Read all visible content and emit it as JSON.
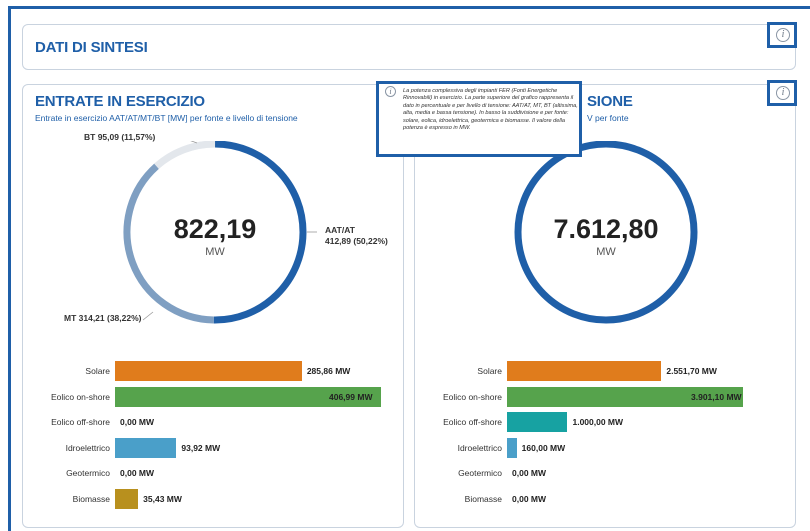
{
  "summary": {
    "title": "DATI DI SINTESI"
  },
  "info_icon_glyph": "i",
  "left_card": {
    "title": "ENTRATE IN ESERCIZIO",
    "subtitle": "Entrate in esercizio AAT/AT/MT/BT [MW] per fonte e livello di tensione",
    "total_value": "822,19",
    "unit": "MW",
    "segments": [
      {
        "name": "AAT/AT",
        "value_text": "412,89 (50,22%)",
        "fraction": 0.5022,
        "color": "#1f5fa8"
      },
      {
        "name": "MT",
        "value_text": "314,21 (38,22%)",
        "fraction": 0.3822,
        "color": "#7f9fc2"
      },
      {
        "name": "BT",
        "value_text": "95,09 (11,57%)",
        "fraction": 0.1157,
        "color": "#e3e7ec"
      }
    ],
    "bt_label": "BT 95,09 (11,57%)",
    "aat_label_line1": "AAT/AT",
    "aat_label_line2": "412,89 (50,22%)",
    "mt_label": "MT 314,21 (38,22%)",
    "bars": [
      {
        "label": "Solare",
        "value": 285.86,
        "value_text": "285,86 MW",
        "color": "#e07c1c"
      },
      {
        "label": "Eolico on-shore",
        "value": 406.99,
        "value_text": "406,99 MW",
        "color": "#56a34c"
      },
      {
        "label": "Eolico off-shore",
        "value": 0,
        "value_text": "0,00 MW",
        "color": "#17a2a2"
      },
      {
        "label": "Idroelettrico",
        "value": 93.92,
        "value_text": "93,92 MW",
        "color": "#4a9fc9"
      },
      {
        "label": "Geotermico",
        "value": 0,
        "value_text": "0,00 MW",
        "color": "#999999"
      },
      {
        "label": "Biomasse",
        "value": 35.43,
        "value_text": "35,43 MW",
        "color": "#b8901e"
      }
    ]
  },
  "right_card": {
    "title_visible": "SIONE",
    "subtitle_visible": "V per fonte",
    "total_value": "7.612,80",
    "unit": "MW",
    "ring_color": "#1f5fa8",
    "bars": [
      {
        "label": "Solare",
        "value": 2551.7,
        "value_text": "2.551,70 MW",
        "color": "#e07c1c"
      },
      {
        "label": "Eolico on-shore",
        "value": 3901.1,
        "value_text": "3.901,10 MW",
        "color": "#56a34c"
      },
      {
        "label": "Eolico off-shore",
        "value": 1000.0,
        "value_text": "1.000,00 MW",
        "color": "#17a2a2"
      },
      {
        "label": "Idroelettrico",
        "value": 160.0,
        "value_text": "160,00 MW",
        "color": "#4a9fc9"
      },
      {
        "label": "Geotermico",
        "value": 0,
        "value_text": "0,00 MW",
        "color": "#999999"
      },
      {
        "label": "Biomasse",
        "value": 0,
        "value_text": "0,00 MW",
        "color": "#b8901e"
      }
    ]
  },
  "tooltip": {
    "text": "La potenza complessiva degli impianti FER (Fonti Energetiche Rinnovabili) in esercizio. La parte superiore del grafico rappresenta il dato in percentuale e per livello di tensione: AAT/AT, MT, BT (altissima, alta, media e bassa tensione). In basso la suddivisione e per fonte: solare, eolica, idroelettrica, geotermica e biomasse. Il valore della potenza è espresso in MW."
  }
}
